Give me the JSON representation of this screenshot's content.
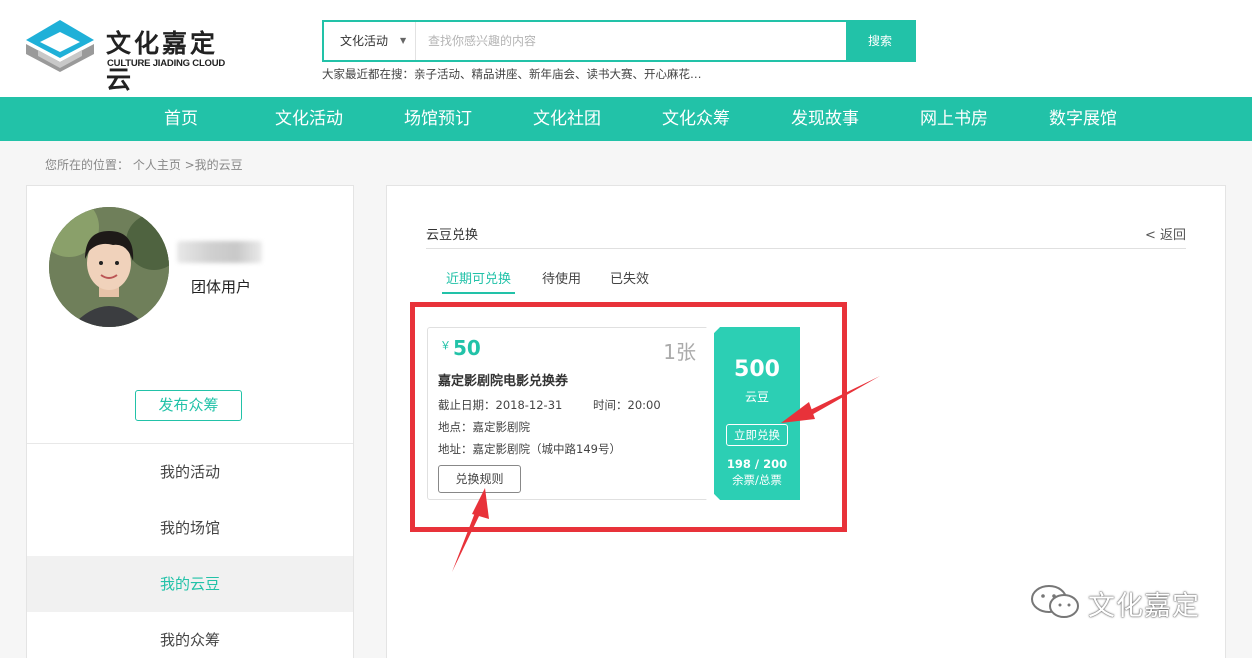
{
  "header": {
    "logo_cn": "文化嘉定云",
    "logo_en": "CULTURE JIADING CLOUD",
    "search": {
      "category": "文化活动",
      "placeholder": "查找你感兴趣的内容",
      "button": "搜索"
    },
    "hot_searches": "大家最近都在搜：亲子活动、精品讲座、新年庙会、读书大赛、开心麻花…"
  },
  "nav": [
    "首页",
    "文化活动",
    "场馆预订",
    "文化社团",
    "文化众筹",
    "发现故事",
    "网上书房",
    "数字展馆"
  ],
  "breadcrumb": "您所在的位置： 个人主页 >我的云豆",
  "sidebar": {
    "user_type": "团体用户",
    "publish_button": "发布众筹",
    "items": [
      "我的活动",
      "我的场馆",
      "我的云豆",
      "我的众筹"
    ],
    "active_index": 2
  },
  "panel": {
    "title": "云豆兑换",
    "back": "< 返回",
    "tabs": [
      "近期可兑换",
      "待使用",
      "已失效"
    ],
    "active_tab": 0
  },
  "ticket": {
    "currency": "￥",
    "price": "50",
    "count": "1张",
    "name": "嘉定影剧院电影兑换券",
    "deadline": "截止日期：2018-12-31",
    "time": "时间：20:00",
    "place": "地点：嘉定影剧院",
    "address": "地址：嘉定影剧院（城中路149号）",
    "rules_button": "兑换规则",
    "beans": "500",
    "beans_unit": "云豆",
    "redeem_button": "立即兑换",
    "stock": "198 / 200",
    "stock_label": "余票/总票"
  },
  "watermark": "文化嘉定",
  "colors": {
    "accent": "#22c2a8",
    "highlight": "#e8323a"
  }
}
